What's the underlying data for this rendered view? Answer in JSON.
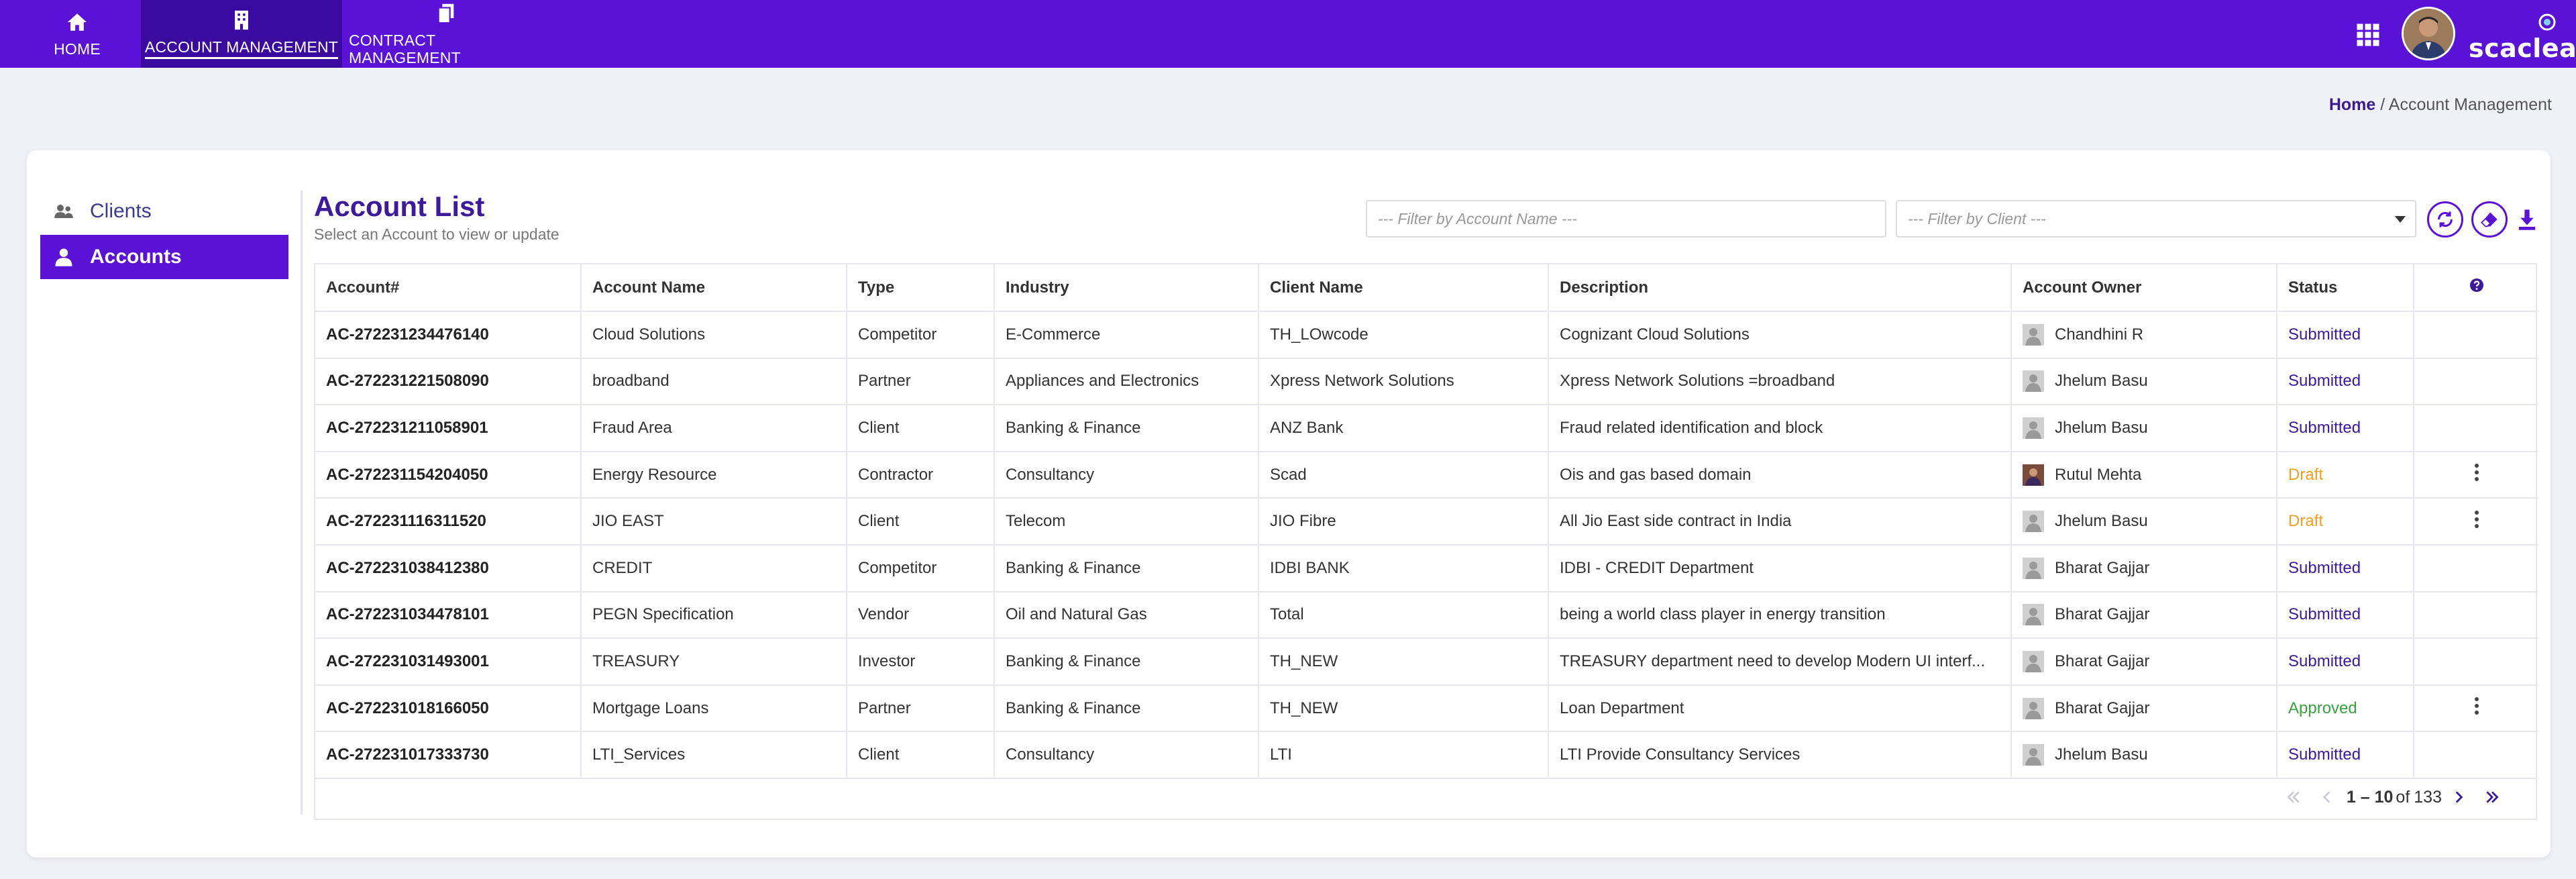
{
  "nav": {
    "items": [
      {
        "label": "HOME",
        "icon": "home-icon"
      },
      {
        "label": "ACCOUNT MANAGEMENT",
        "icon": "building-icon",
        "active": true
      },
      {
        "label": "CONTRACT MANAGEMENT",
        "icon": "documents-icon"
      }
    ],
    "brand": "scaclea"
  },
  "breadcrumb": {
    "home": "Home",
    "separator": " / ",
    "current": "Account Management"
  },
  "sidebar": {
    "items": [
      {
        "label": "Clients",
        "icon": "users-icon"
      },
      {
        "label": "Accounts",
        "icon": "user-icon",
        "active": true
      }
    ]
  },
  "list": {
    "title": "Account List",
    "subtitle": "Select an Account to view or update",
    "filter_account_placeholder": "--- Filter by Account Name ---",
    "filter_client_placeholder": "--- Filter by Client ---"
  },
  "table": {
    "columns": [
      "Account#",
      "Account Name",
      "Type",
      "Industry",
      "Client Name",
      "Description",
      "Account Owner",
      "Status"
    ],
    "rows": [
      {
        "id": "AC-272231234476140",
        "name": "Cloud Solutions",
        "type": "Competitor",
        "industry": "E-Commerce",
        "client": "TH_LOwcode",
        "description": "Cognizant Cloud Solutions",
        "owner": "Chandhini R",
        "owner_photo": false,
        "status": "Submitted",
        "menu": false
      },
      {
        "id": "AC-272231221508090",
        "name": "broadband",
        "type": "Partner",
        "industry": "Appliances and Electronics",
        "client": "Xpress Network Solutions",
        "description": "Xpress Network Solutions =broadband",
        "owner": "Jhelum Basu",
        "owner_photo": false,
        "status": "Submitted",
        "menu": false
      },
      {
        "id": "AC-272231211058901",
        "name": "Fraud Area",
        "type": "Client",
        "industry": "Banking & Finance",
        "client": "ANZ Bank",
        "description": "Fraud related identification and block",
        "owner": "Jhelum Basu",
        "owner_photo": false,
        "status": "Submitted",
        "menu": false
      },
      {
        "id": "AC-272231154204050",
        "name": "Energy Resource",
        "type": "Contractor",
        "industry": "Consultancy",
        "client": "Scad",
        "description": "Ois and gas based domain",
        "owner": "Rutul Mehta",
        "owner_photo": true,
        "status": "Draft",
        "menu": true
      },
      {
        "id": "AC-272231116311520",
        "name": "JIO EAST",
        "type": "Client",
        "industry": "Telecom",
        "client": "JIO Fibre",
        "description": "All Jio East side contract in India",
        "owner": "Jhelum Basu",
        "owner_photo": false,
        "status": "Draft",
        "menu": true
      },
      {
        "id": "AC-272231038412380",
        "name": "CREDIT",
        "type": "Competitor",
        "industry": "Banking & Finance",
        "client": "IDBI BANK",
        "description": "IDBI - CREDIT Department",
        "owner": "Bharat Gajjar",
        "owner_photo": false,
        "status": "Submitted",
        "menu": false
      },
      {
        "id": "AC-272231034478101",
        "name": "PEGN Specification",
        "type": "Vendor",
        "industry": "Oil and Natural Gas",
        "client": "Total",
        "description": "being a world class player in energy transition",
        "owner": "Bharat Gajjar",
        "owner_photo": false,
        "status": "Submitted",
        "menu": false
      },
      {
        "id": "AC-272231031493001",
        "name": "TREASURY",
        "type": "Investor",
        "industry": "Banking & Finance",
        "client": "TH_NEW",
        "description": "TREASURY department need to develop Modern UI interf...",
        "owner": "Bharat Gajjar",
        "owner_photo": false,
        "status": "Submitted",
        "menu": false
      },
      {
        "id": "AC-272231018166050",
        "name": "Mortgage Loans",
        "type": "Partner",
        "industry": "Banking & Finance",
        "client": "TH_NEW",
        "description": "Loan Department",
        "owner": "Bharat Gajjar",
        "owner_photo": false,
        "status": "Approved",
        "menu": true
      },
      {
        "id": "AC-272231017333730",
        "name": "LTI_Services",
        "type": "Client",
        "industry": "Consultancy",
        "client": "LTI",
        "description": "LTI Provide Consultancy Services",
        "owner": "Jhelum Basu",
        "owner_photo": false,
        "status": "Submitted",
        "menu": false
      }
    ]
  },
  "pagination": {
    "range": "1 – 10",
    "of_label": "of",
    "total": "133"
  },
  "colors": {
    "primary": "#5a12d6",
    "active_nav": "#3b0ba0",
    "title": "#3b1a9c",
    "submitted": "#3b1a9c",
    "draft": "#f0a020",
    "approved": "#3aa043"
  }
}
